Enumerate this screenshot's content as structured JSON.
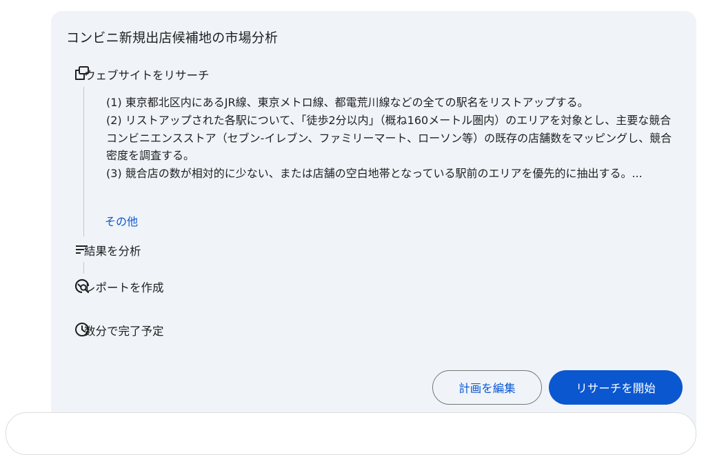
{
  "card": {
    "title": "コンビニ新規出店候補地の市場分析"
  },
  "steps": [
    {
      "icon": "browser-windows-icon",
      "label": "ウェブサイトをリサーチ"
    },
    {
      "icon": "sort-lines-icon",
      "label": "結果を分析"
    },
    {
      "icon": "report-search-icon",
      "label": "レポートを作成"
    },
    {
      "icon": "clock-icon",
      "label": "数分で完了予定"
    }
  ],
  "plan": {
    "lines": [
      "(1) 東京都北区内にあるJR線、東京メトロ線、都電荒川線などの全ての駅名をリストアップする。",
      "(2) リストアップされた各駅について、「徒歩2分以内」（概ね160メートル圏内）のエリアを対象とし、主要な競合コンビニエンスストア（セブン-イレブン、ファミリーマート、ローソン等）の既存の店舗数をマッピングし、競合密度を調査する。",
      "(3) 競合店の数が相対的に少ない、または店舗の空白地帯となっている駅前のエリアを優先的に抽出する。..."
    ],
    "more_label": "その他"
  },
  "buttons": {
    "edit_label": "計画を編集",
    "start_label": "リサーチを開始"
  },
  "colors": {
    "card_bg": "#f0f4f9",
    "accent": "#0b57d0",
    "text": "#1f1f1f"
  }
}
